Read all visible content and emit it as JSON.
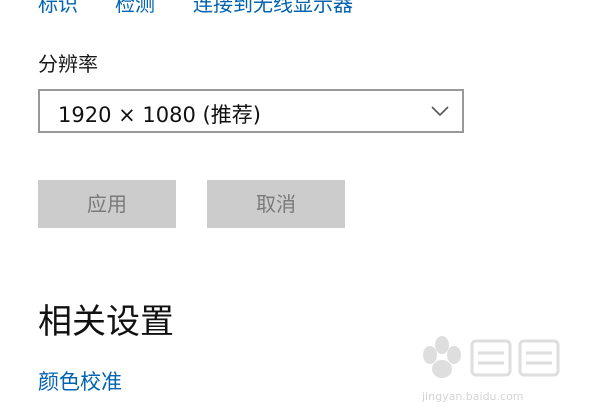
{
  "top_links": {
    "identify": "标识",
    "detect": "检测",
    "connect_wireless": "连接到无线显示器"
  },
  "resolution": {
    "label": "分辨率",
    "value": "1920 × 1080 (推荐)"
  },
  "buttons": {
    "apply": "应用",
    "cancel": "取消"
  },
  "related": {
    "heading": "相关设置",
    "color_calibration": "颜色校准"
  },
  "watermark": {
    "url": "jingyan.baidu.com"
  },
  "colors": {
    "link": "#0063b1",
    "button_disabled_bg": "#cccccc",
    "button_disabled_text": "#7a7a7a",
    "select_border": "#999999"
  },
  "icons": {
    "dropdown": "chevron-down-icon",
    "watermark": "baidu-jingyan-logo"
  }
}
